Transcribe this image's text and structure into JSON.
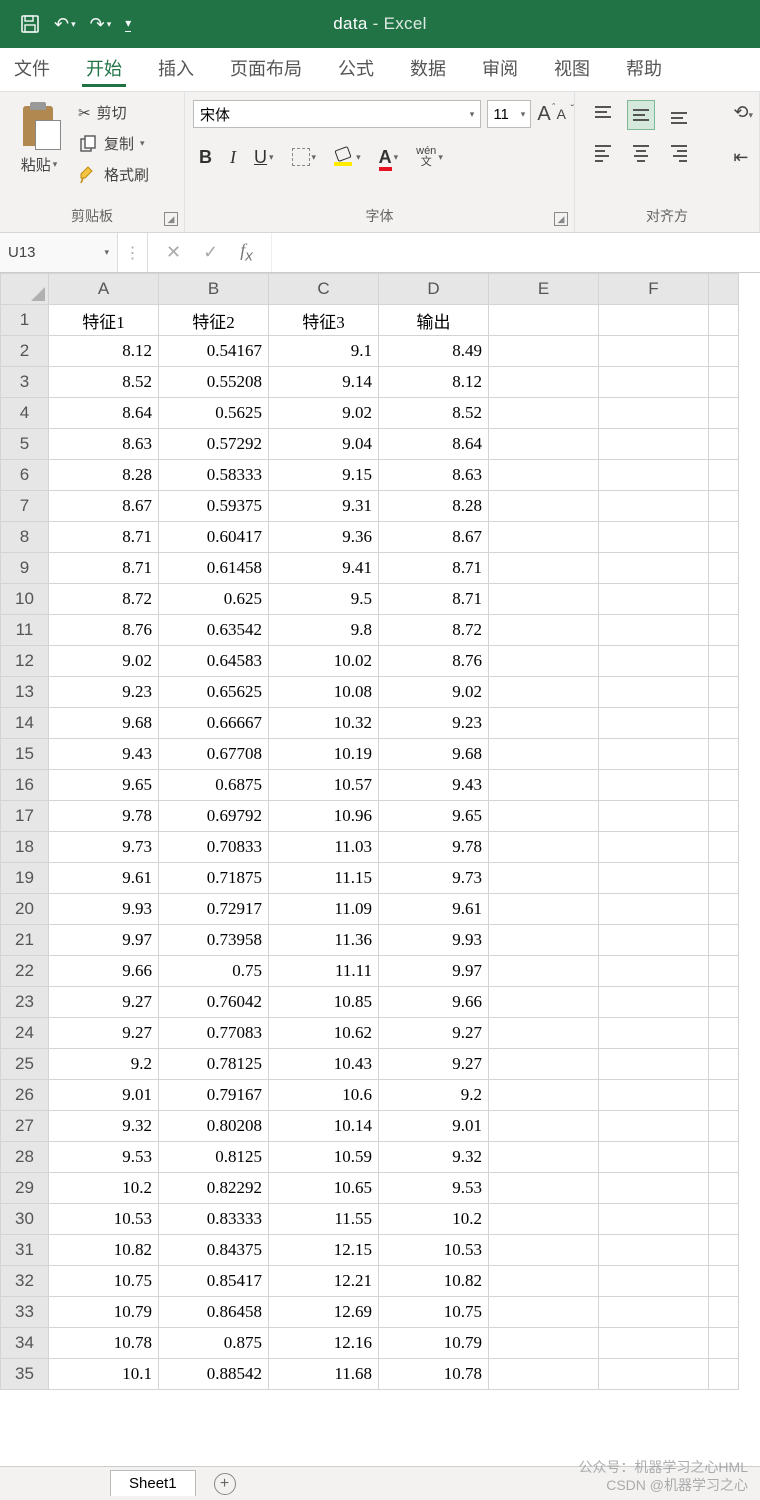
{
  "title": {
    "doc": "data",
    "app": "Excel",
    "sep": " - "
  },
  "qat": {
    "save": "save-icon",
    "undo": "undo-icon",
    "redo": "redo-icon",
    "custom": "customize-icon"
  },
  "tabs": [
    "文件",
    "开始",
    "插入",
    "页面布局",
    "公式",
    "数据",
    "审阅",
    "视图",
    "帮助"
  ],
  "active_tab": 1,
  "ribbon": {
    "clipboard": {
      "paste": "粘贴",
      "cut": "剪切",
      "copy": "复制",
      "format_painter": "格式刷",
      "label": "剪贴板"
    },
    "font": {
      "name": "宋体",
      "size": "11",
      "label": "字体",
      "wen_top": "wén",
      "wen_bot": "文"
    },
    "align": {
      "label": "对齐方"
    }
  },
  "namebox": "U13",
  "columns": [
    "A",
    "B",
    "C",
    "D",
    "E",
    "F"
  ],
  "headers": [
    "特征1",
    "特征2",
    "特征3",
    "输出"
  ],
  "rows": [
    [
      "8.12",
      "0.54167",
      "9.1",
      "8.49"
    ],
    [
      "8.52",
      "0.55208",
      "9.14",
      "8.12"
    ],
    [
      "8.64",
      "0.5625",
      "9.02",
      "8.52"
    ],
    [
      "8.63",
      "0.57292",
      "9.04",
      "8.64"
    ],
    [
      "8.28",
      "0.58333",
      "9.15",
      "8.63"
    ],
    [
      "8.67",
      "0.59375",
      "9.31",
      "8.28"
    ],
    [
      "8.71",
      "0.60417",
      "9.36",
      "8.67"
    ],
    [
      "8.71",
      "0.61458",
      "9.41",
      "8.71"
    ],
    [
      "8.72",
      "0.625",
      "9.5",
      "8.71"
    ],
    [
      "8.76",
      "0.63542",
      "9.8",
      "8.72"
    ],
    [
      "9.02",
      "0.64583",
      "10.02",
      "8.76"
    ],
    [
      "9.23",
      "0.65625",
      "10.08",
      "9.02"
    ],
    [
      "9.68",
      "0.66667",
      "10.32",
      "9.23"
    ],
    [
      "9.43",
      "0.67708",
      "10.19",
      "9.68"
    ],
    [
      "9.65",
      "0.6875",
      "10.57",
      "9.43"
    ],
    [
      "9.78",
      "0.69792",
      "10.96",
      "9.65"
    ],
    [
      "9.73",
      "0.70833",
      "11.03",
      "9.78"
    ],
    [
      "9.61",
      "0.71875",
      "11.15",
      "9.73"
    ],
    [
      "9.93",
      "0.72917",
      "11.09",
      "9.61"
    ],
    [
      "9.97",
      "0.73958",
      "11.36",
      "9.93"
    ],
    [
      "9.66",
      "0.75",
      "11.11",
      "9.97"
    ],
    [
      "9.27",
      "0.76042",
      "10.85",
      "9.66"
    ],
    [
      "9.27",
      "0.77083",
      "10.62",
      "9.27"
    ],
    [
      "9.2",
      "0.78125",
      "10.43",
      "9.27"
    ],
    [
      "9.01",
      "0.79167",
      "10.6",
      "9.2"
    ],
    [
      "9.32",
      "0.80208",
      "10.14",
      "9.01"
    ],
    [
      "9.53",
      "0.8125",
      "10.59",
      "9.32"
    ],
    [
      "10.2",
      "0.82292",
      "10.65",
      "9.53"
    ],
    [
      "10.53",
      "0.83333",
      "11.55",
      "10.2"
    ],
    [
      "10.82",
      "0.84375",
      "12.15",
      "10.53"
    ],
    [
      "10.75",
      "0.85417",
      "12.21",
      "10.82"
    ],
    [
      "10.79",
      "0.86458",
      "12.69",
      "10.75"
    ],
    [
      "10.78",
      "0.875",
      "12.16",
      "10.79"
    ],
    [
      "10.1",
      "0.88542",
      "11.68",
      "10.78"
    ]
  ],
  "sheet_tab": "Sheet1",
  "watermark": {
    "l1": "公众号：机器学习之心HML",
    "l2": "CSDN @机器学习之心"
  }
}
